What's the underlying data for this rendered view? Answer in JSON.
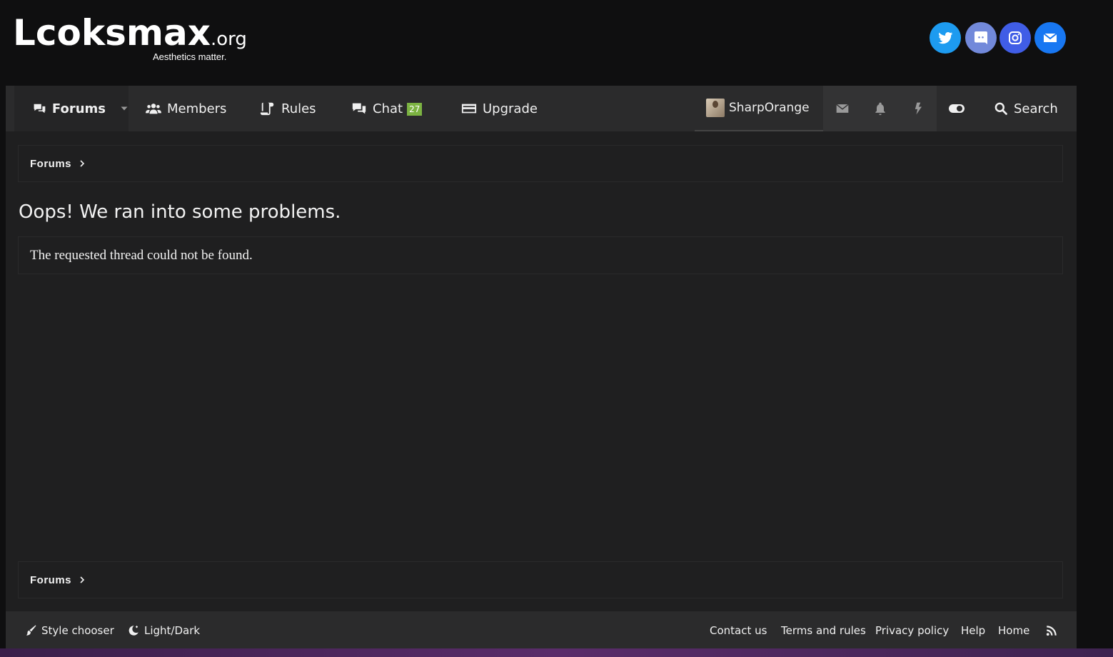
{
  "header": {
    "logo_text": "Lcoksmax",
    "logo_org": ".org",
    "tagline": "Aesthetics matter.",
    "social": [
      {
        "name": "twitter-icon",
        "color": "#1d9bf0"
      },
      {
        "name": "discord-icon",
        "color": "#7289da"
      },
      {
        "name": "instagram-icon",
        "color": "#405de6"
      },
      {
        "name": "email-icon",
        "color": "#1877f2"
      }
    ]
  },
  "nav": {
    "forums": "Forums",
    "members": "Members",
    "rules": "Rules",
    "chat": "Chat",
    "chat_badge": "27",
    "upgrade": "Upgrade",
    "username": "SharpOrange",
    "search": "Search"
  },
  "breadcrumb": {
    "top": "Forums",
    "bottom": "Forums"
  },
  "main": {
    "title": "Oops! We ran into some problems.",
    "message": "The requested thread could not be found."
  },
  "footer": {
    "style_chooser": "Style chooser",
    "light_dark": "Light/Dark",
    "links": [
      "Contact us",
      "Terms and rules",
      "Privacy policy",
      "Help",
      "Home"
    ]
  }
}
